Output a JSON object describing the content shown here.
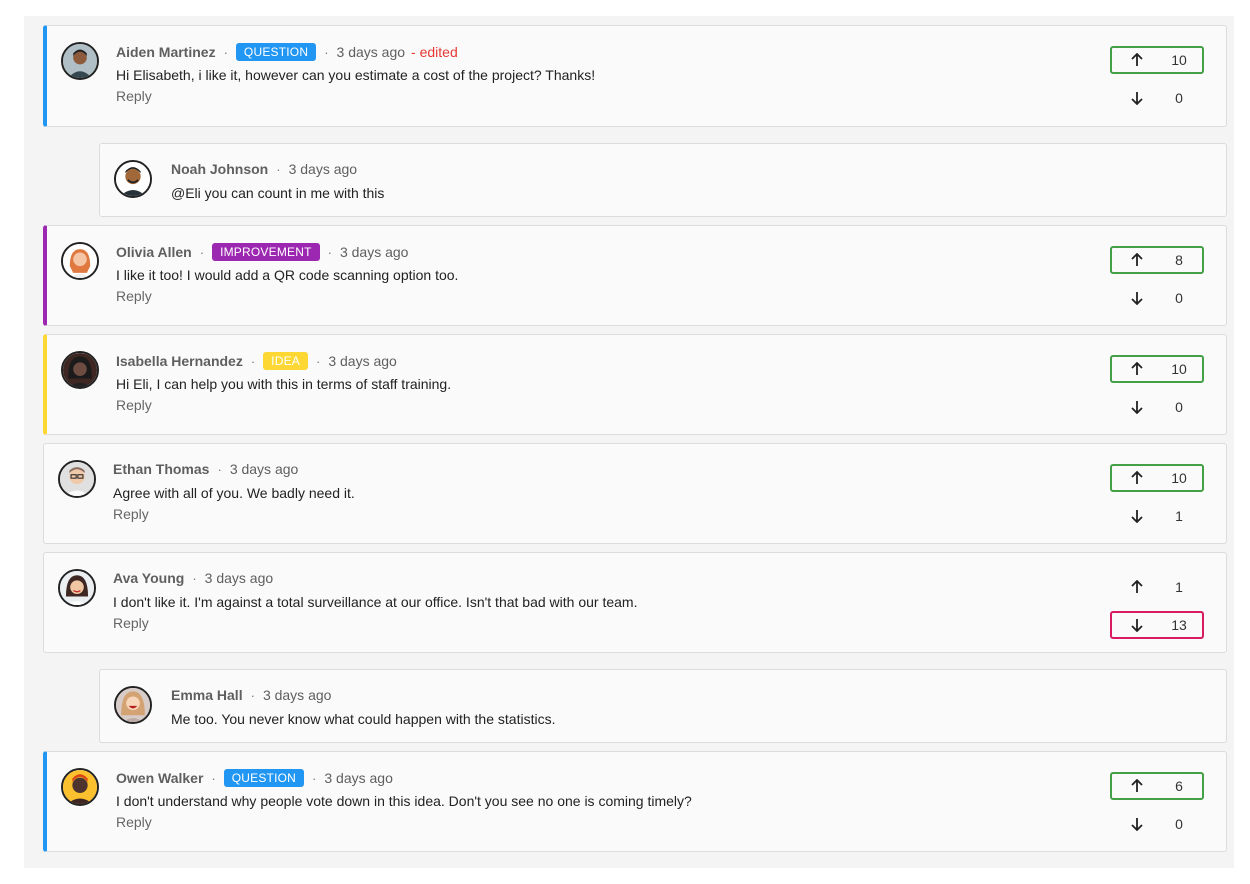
{
  "colors": {
    "question": "#2196f3",
    "improvement": "#9c27b0",
    "idea": "#fdd835",
    "upvote_border": "#43a047",
    "downvote_border": "#d81b60",
    "edited": "#e53935"
  },
  "reply_label": "Reply",
  "comments": [
    {
      "author": "Aiden Martinez",
      "badge": "QUESTION",
      "time": "3 days ago",
      "edited": "- edited",
      "text": "Hi Elisabeth, i like it, however can you estimate a cost of the project? Thanks!",
      "reply": "Reply",
      "upvotes": "10",
      "downvotes": "0"
    },
    {
      "author": "Noah Johnson",
      "time": "3 days ago",
      "text": "@Eli you can count in me with this"
    },
    {
      "author": "Olivia Allen",
      "badge": "IMPROVEMENT",
      "time": "3 days ago",
      "text": "I like it too! I would add a QR code scanning option too.",
      "reply": "Reply",
      "upvotes": "8",
      "downvotes": "0"
    },
    {
      "author": "Isabella Hernandez",
      "badge": "IDEA",
      "time": "3 days ago",
      "text": "Hi Eli, I can help you with this in terms of staff training.",
      "reply": "Reply",
      "upvotes": "10",
      "downvotes": "0"
    },
    {
      "author": "Ethan Thomas",
      "time": "3 days ago",
      "text": "Agree with all of you. We badly need it.",
      "reply": "Reply",
      "upvotes": "10",
      "downvotes": "1"
    },
    {
      "author": "Ava Young",
      "time": "3 days ago",
      "text": "I don't like it. I'm against a total surveillance at our office. Isn't that bad with our team.",
      "reply": "Reply",
      "upvotes": "1",
      "downvotes": "13"
    },
    {
      "author": "Emma Hall",
      "time": "3 days ago",
      "text": "Me too. You never know what could happen with the statistics."
    },
    {
      "author": "Owen Walker",
      "badge": "QUESTION",
      "time": "3 days ago",
      "text": "I don't understand why people vote down in this idea. Don't you see no one is coming timely?",
      "reply": "Reply",
      "upvotes": "6",
      "downvotes": "0"
    }
  ]
}
